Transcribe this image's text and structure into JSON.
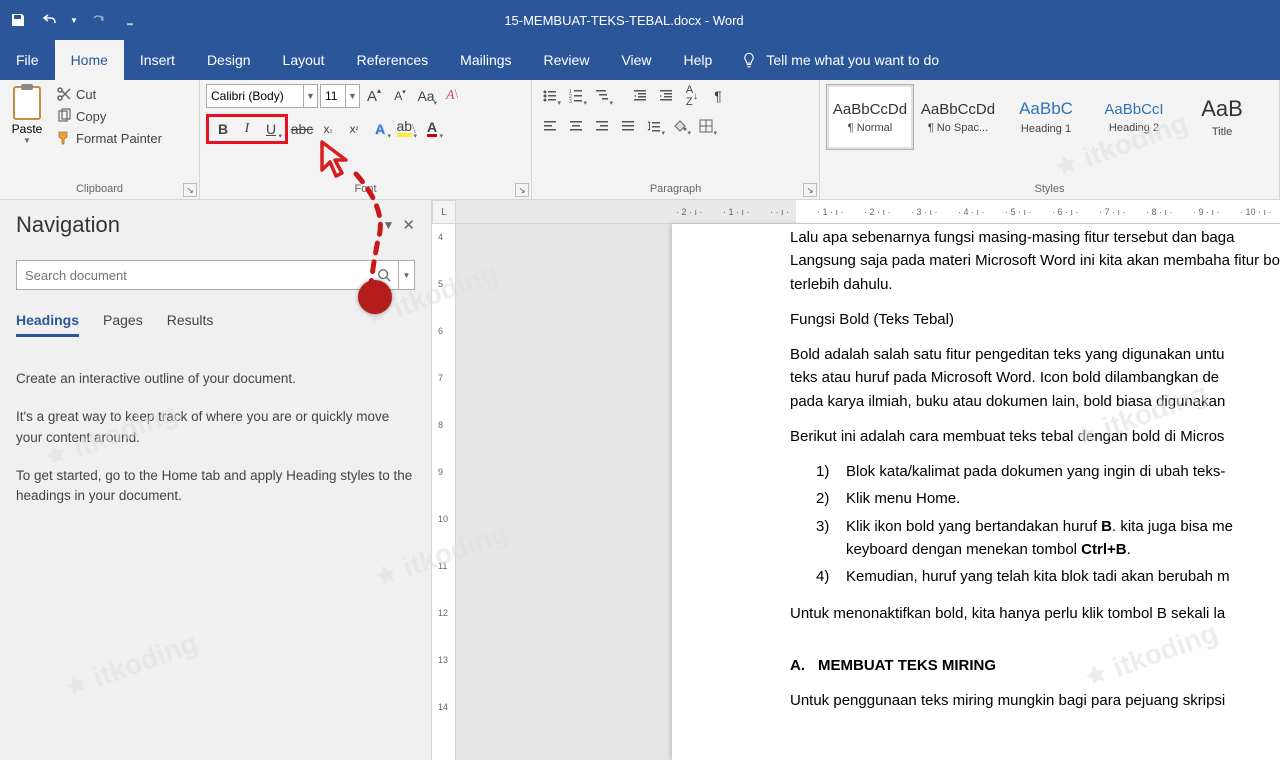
{
  "title": "15-MEMBUAT-TEKS-TEBAL.docx  -  Word",
  "tabs": [
    "File",
    "Home",
    "Insert",
    "Design",
    "Layout",
    "References",
    "Mailings",
    "Review",
    "View",
    "Help"
  ],
  "active_tab": 1,
  "tellme": "Tell me what you want to do",
  "clipboard": {
    "paste": "Paste",
    "cut": "Cut",
    "copy": "Copy",
    "fp": "Format Painter",
    "label": "Clipboard"
  },
  "font": {
    "name": "Calibri (Body)",
    "size": "11",
    "label": "Font"
  },
  "paragraph": {
    "label": "Paragraph"
  },
  "styles": {
    "label": "Styles",
    "items": [
      {
        "sample": "AaBbCcDd",
        "name": "¶ Normal",
        "cls": ""
      },
      {
        "sample": "AaBbCcDd",
        "name": "¶ No Spac...",
        "cls": ""
      },
      {
        "sample": "AaBbC",
        "name": "Heading 1",
        "cls": "h1"
      },
      {
        "sample": "AaBbCcI",
        "name": "Heading 2",
        "cls": "h2"
      },
      {
        "sample": "AaB",
        "name": "Title",
        "cls": "title"
      }
    ]
  },
  "nav": {
    "title": "Navigation",
    "search_ph": "Search document",
    "tabs": [
      "Headings",
      "Pages",
      "Results"
    ],
    "body": [
      "Create an interactive outline of your document.",
      "It's a great way to keep track of where you are or quickly move your content around.",
      "To get started, go to the Home tab and apply Heading styles to the headings in your document."
    ]
  },
  "doc": {
    "p1": "Lalu apa sebenarnya fungsi masing-masing fitur tersebut dan baga",
    "p1b": "Langsung saja pada materi Microsoft Word ini kita akan membaha",
    "p1c": "fitur bold terlebih dahulu.",
    "h1": "Fungsi Bold (Teks Tebal)",
    "p2": "Bold adalah salah satu fitur pengeditan teks yang digunakan untu",
    "p2b": "teks atau huruf pada Microsoft Word. Icon bold dilambangkan de",
    "p2c": "pada karya ilmiah, buku atau dokumen lain, bold biasa digunakan",
    "p3": "Berikut ini adalah cara membuat teks tebal dengan bold di Micros",
    "li1": "Blok kata/kalimat pada dokumen yang ingin di ubah teks-",
    "li2": "Klik menu Home.",
    "li3a": "Klik ikon bold yang bertandakan huruf ",
    "li3b": ". kita juga bisa me",
    "li3c": "keyboard dengan menekan tombol ",
    "li4": "Kemudian, huruf yang telah kita blok tadi akan berubah m",
    "p4": "Untuk menonaktifkan bold, kita hanya perlu klik tombol B sekali la",
    "hA_let": "A.",
    "hA": "MEMBUAT TEKS MIRING",
    "p5": "Untuk penggunaan teks miring mungkin bagi para pejuang skripsi"
  },
  "hruler_ticks": [
    "2",
    "1",
    "",
    "1",
    "2",
    "3",
    "4",
    "5",
    "6",
    "7",
    "8",
    "9",
    "10"
  ],
  "vruler_ticks": [
    "4",
    "5",
    "6",
    "7",
    "8",
    "9",
    "10",
    "11",
    "12",
    "13",
    "14"
  ],
  "watermark": "itkoding"
}
